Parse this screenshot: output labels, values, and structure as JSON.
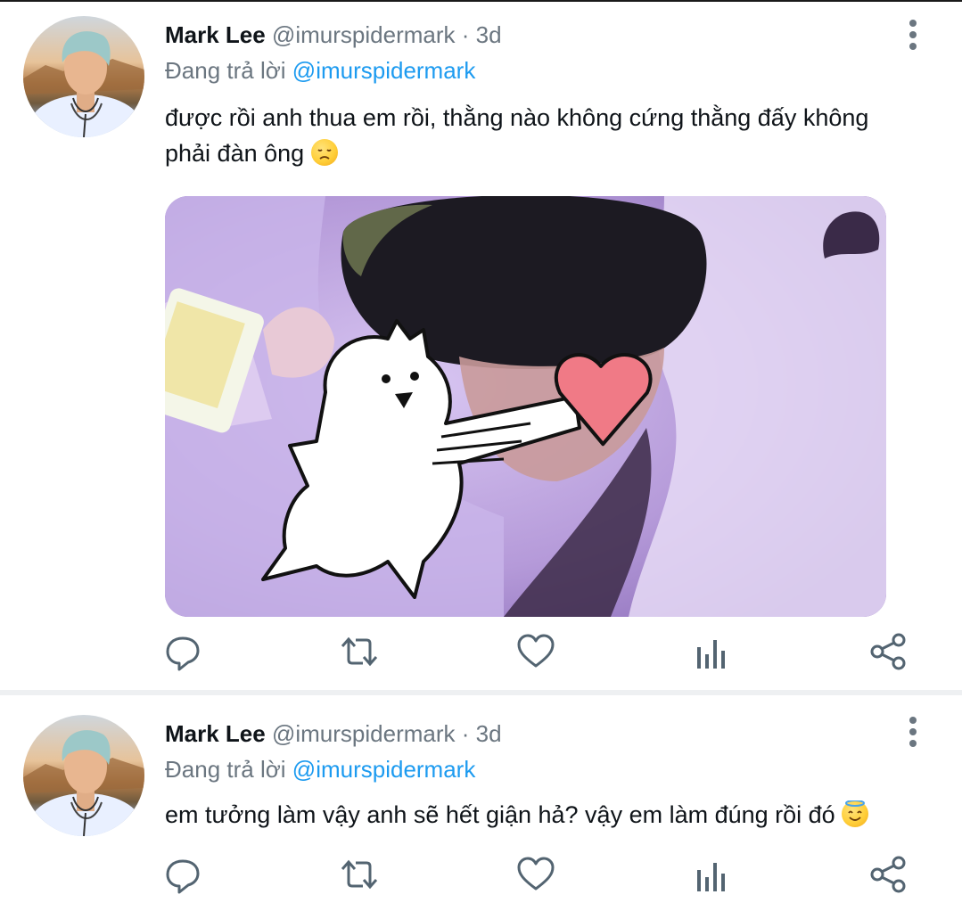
{
  "tweets": [
    {
      "name": "Mark Lee",
      "handle": "@imurspidermark",
      "separator": "·",
      "time": "3d",
      "reply_prefix": "Đang trả lời",
      "reply_handle": "@imurspidermark",
      "text": "được rồi anh thua em rồi, thằng nào không cứng thằng đấy không phải đàn ông",
      "emoji": "disappointed-face",
      "has_media": true,
      "actions": [
        "reply-icon",
        "retweet-icon",
        "like-icon",
        "analytics-icon",
        "share-icon"
      ]
    },
    {
      "name": "Mark Lee",
      "handle": "@imurspidermark",
      "separator": "·",
      "time": "3d",
      "reply_prefix": "Đang trả lời",
      "reply_handle": "@imurspidermark",
      "text": "em tưởng làm vậy anh sẽ hết giận hả? vậy em làm đúng rồi đó",
      "emoji": "smiling-face-with-halo",
      "has_media": false,
      "actions": [
        "reply-icon",
        "retweet-icon",
        "like-icon",
        "analytics-icon",
        "share-icon"
      ]
    }
  ],
  "colors": {
    "text": "#0f1419",
    "secondary": "#6b7680",
    "link": "#1d9bf0",
    "divider": "#eef0f2"
  }
}
